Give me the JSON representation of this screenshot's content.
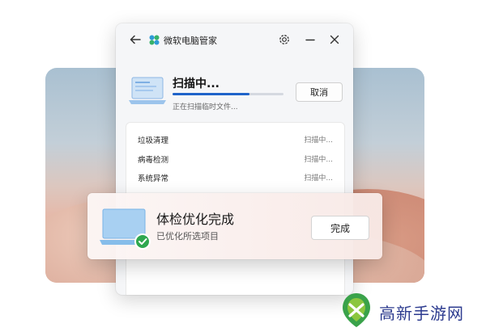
{
  "window": {
    "title": "微软电脑管家",
    "icons": [
      "back-arrow-icon",
      "app-logo-icon",
      "gear-icon",
      "minimize-icon",
      "close-icon"
    ]
  },
  "scan": {
    "title": "扫描中...",
    "subtitle": "正在扫描临时文件...",
    "progress_fraction": 0.69,
    "cancel_label": "取消"
  },
  "scan_list": [
    {
      "name": "垃圾清理",
      "status": "扫描中..."
    },
    {
      "name": "病毒检测",
      "status": "扫描中..."
    },
    {
      "name": "系统异常",
      "status": "扫描中..."
    }
  ],
  "toast": {
    "title": "体检优化完成",
    "subtitle": "已优化所选项目",
    "done_label": "完成"
  },
  "watermark": {
    "text": "高新手游网"
  },
  "colors": {
    "accent": "#1f63c9",
    "check": "#2fa84f",
    "watermark": "#2c3b8f"
  }
}
